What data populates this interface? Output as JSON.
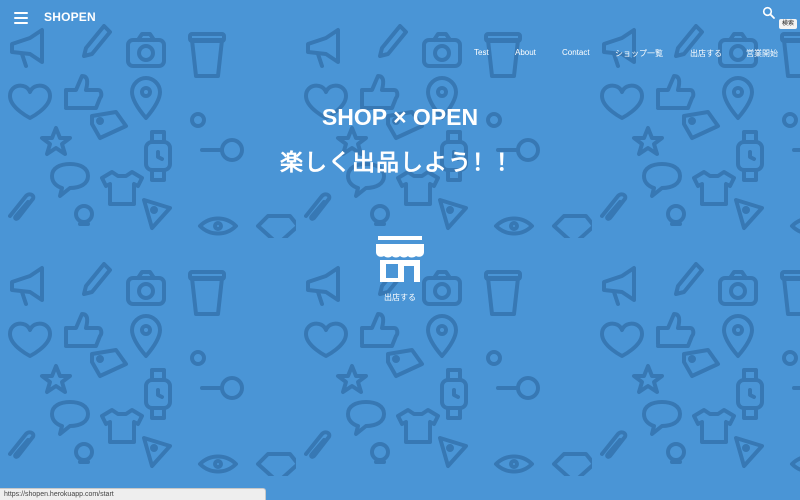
{
  "header": {
    "brand": "SHOPEN",
    "search_tooltip": "検索"
  },
  "nav": {
    "items": [
      {
        "label": "Test"
      },
      {
        "label": "About"
      },
      {
        "label": "Contact"
      },
      {
        "label": "ショップ一覧"
      },
      {
        "label": "出店する"
      },
      {
        "label": "営業開始"
      }
    ]
  },
  "hero": {
    "title": "SHOP × OPEN",
    "subtitle": "楽しく出品しよう！！"
  },
  "cta": {
    "label": "出店する"
  },
  "status_bar": {
    "url": "https://shopen.herokuapp.com/start"
  },
  "colors": {
    "background": "#4a95d6",
    "pattern": "#2e6ba3",
    "text": "#ffffff"
  },
  "icons": {
    "menu": "hamburger-menu-icon",
    "search": "search-icon",
    "store": "store-icon"
  }
}
